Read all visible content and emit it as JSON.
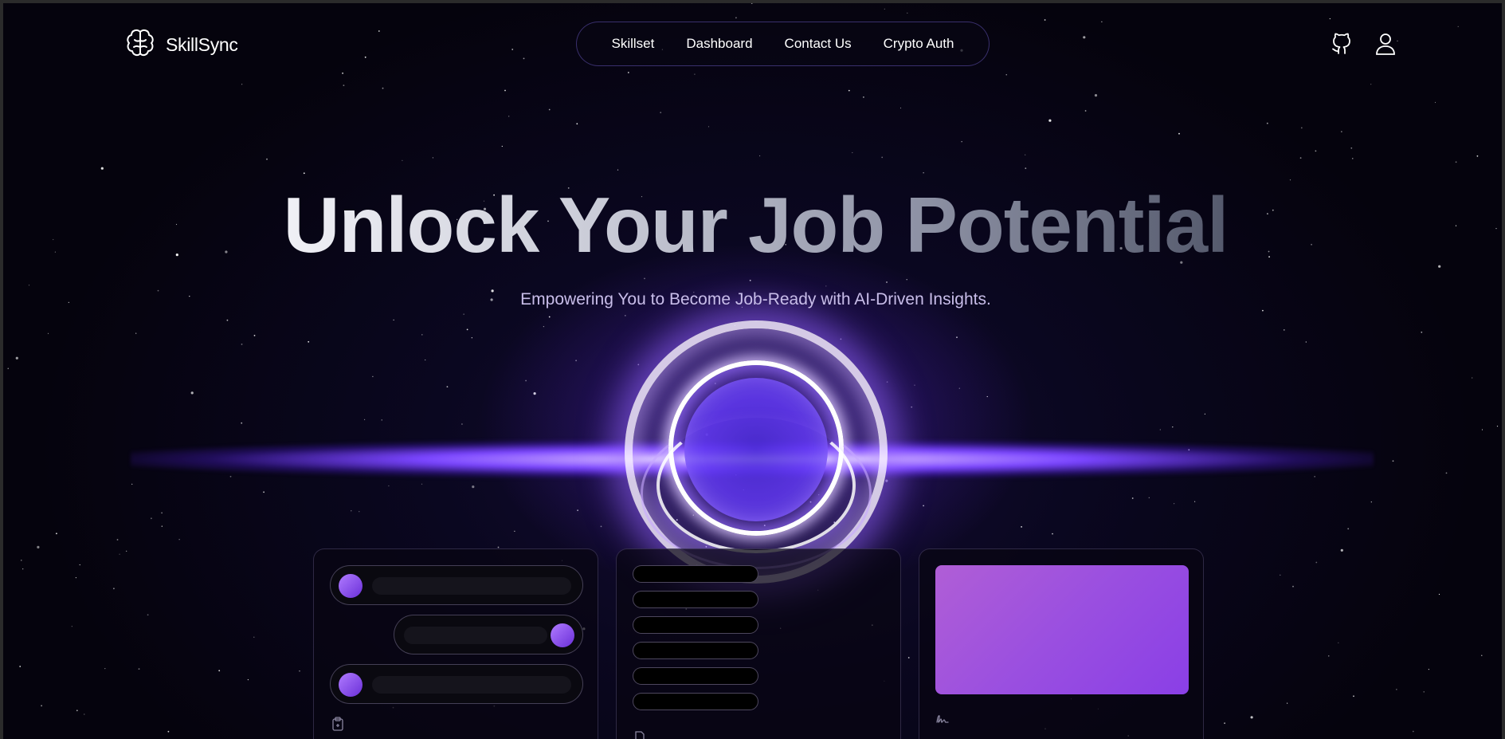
{
  "brand": {
    "name": "SkillSync",
    "logo_icon": "brain-icon"
  },
  "nav": {
    "links": [
      "Skillset",
      "Dashboard",
      "Contact Us",
      "Crypto Auth"
    ]
  },
  "header_icons": [
    "github-icon",
    "user-icon"
  ],
  "hero": {
    "title": "Unlock Your Job Potential",
    "subtitle": "Empowering You to Become Job-Ready with AI-Driven Insights."
  },
  "cards": [
    {
      "type": "chat-preview",
      "footer_icon": "clipboard-icon"
    },
    {
      "type": "list-preview",
      "footer_icon": "document-icon"
    },
    {
      "type": "image-preview",
      "footer_icon": "signature-icon"
    }
  ],
  "colors": {
    "background": "#06040f",
    "accent_purple": "#7a45ff",
    "panel_purple": "#9a4fe0",
    "subtitle": "#c8bde9"
  }
}
